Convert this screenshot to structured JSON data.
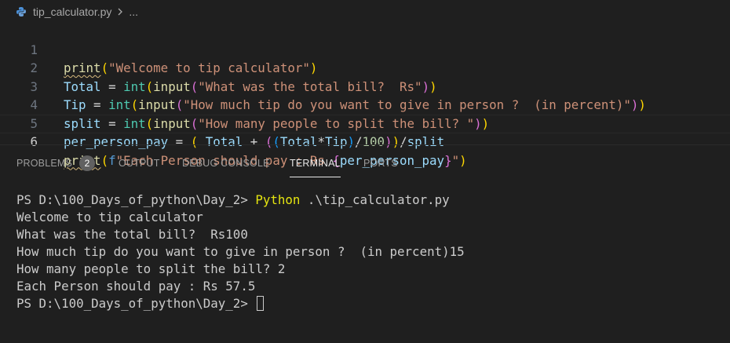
{
  "breadcrumb": {
    "file": "tip_calculator.py",
    "rest": "..."
  },
  "editor": {
    "lines": [
      {
        "n": "1"
      },
      {
        "n": "2"
      },
      {
        "n": "3"
      },
      {
        "n": "4"
      },
      {
        "n": "5"
      },
      {
        "n": "6"
      }
    ],
    "tokens": {
      "l1_print": "print",
      "l1_str": "\"Welcome to tip calculator\"",
      "l2_var": "Total",
      "l2_eq": " = ",
      "l2_int": "int",
      "l2_input": "input",
      "l2_str": "\"What was the total bill?  Rs\"",
      "l3_var": "Tip",
      "l3_eq": " = ",
      "l3_int": "int",
      "l3_input": "input",
      "l3_str": "\"How much tip do you want to give in person ?  (in percent)\"",
      "l4_var": "split",
      "l4_eq": " = ",
      "l4_int": "int",
      "l4_input": "input",
      "l4_str": "\"How many people to split the bill? \"",
      "l5_var": "per_person_pay",
      "l5_eq": " = ",
      "l5_total": "Total",
      "l5_plus": " + ",
      "l5_total2": "Total",
      "l5_mul": "*",
      "l5_tip": "Tip",
      "l5_div": "/",
      "l5_num": "100",
      "l5_div2": "/",
      "l5_split": "split",
      "l6_print": "print",
      "l6_f": "f",
      "l6_str": "\"Each Person should pay : Rs ",
      "l6_var": "per_person_pay",
      "l6_end": "\""
    }
  },
  "panel": {
    "tabs": {
      "problems": "PROBLEMS",
      "problems_count": "2",
      "output": "OUTPUT",
      "debug": "DEBUG CONSOLE",
      "terminal": "TERMINAL",
      "ports": "PORTS"
    }
  },
  "terminal": {
    "prompt1": "PS D:\\100_Days_of_python\\Day_2> ",
    "cmd_python": "Python",
    "cmd_arg": " .\\tip_calculator.py",
    "out1": "Welcome to tip calculator",
    "out2": "What was the total bill?  Rs100",
    "out3": "How much tip do you want to give in person ?  (in percent)15",
    "out4": "How many people to split the bill? 2",
    "out5": "Each Person should pay : Rs 57.5",
    "prompt2": "PS D:\\100_Days_of_python\\Day_2> "
  },
  "colors": {
    "background": "#1f1f1f",
    "function": "#dcdcaa",
    "variable": "#9cdcfe",
    "builtin_type": "#4ec9b0",
    "string": "#ce9178",
    "number": "#b5cea8",
    "bracket1": "#ffd700",
    "bracket2": "#da70d6",
    "bracket3": "#179fff"
  },
  "icons": {
    "file_icon": "python-file-icon",
    "separator_icon": "chevron-right-icon"
  }
}
